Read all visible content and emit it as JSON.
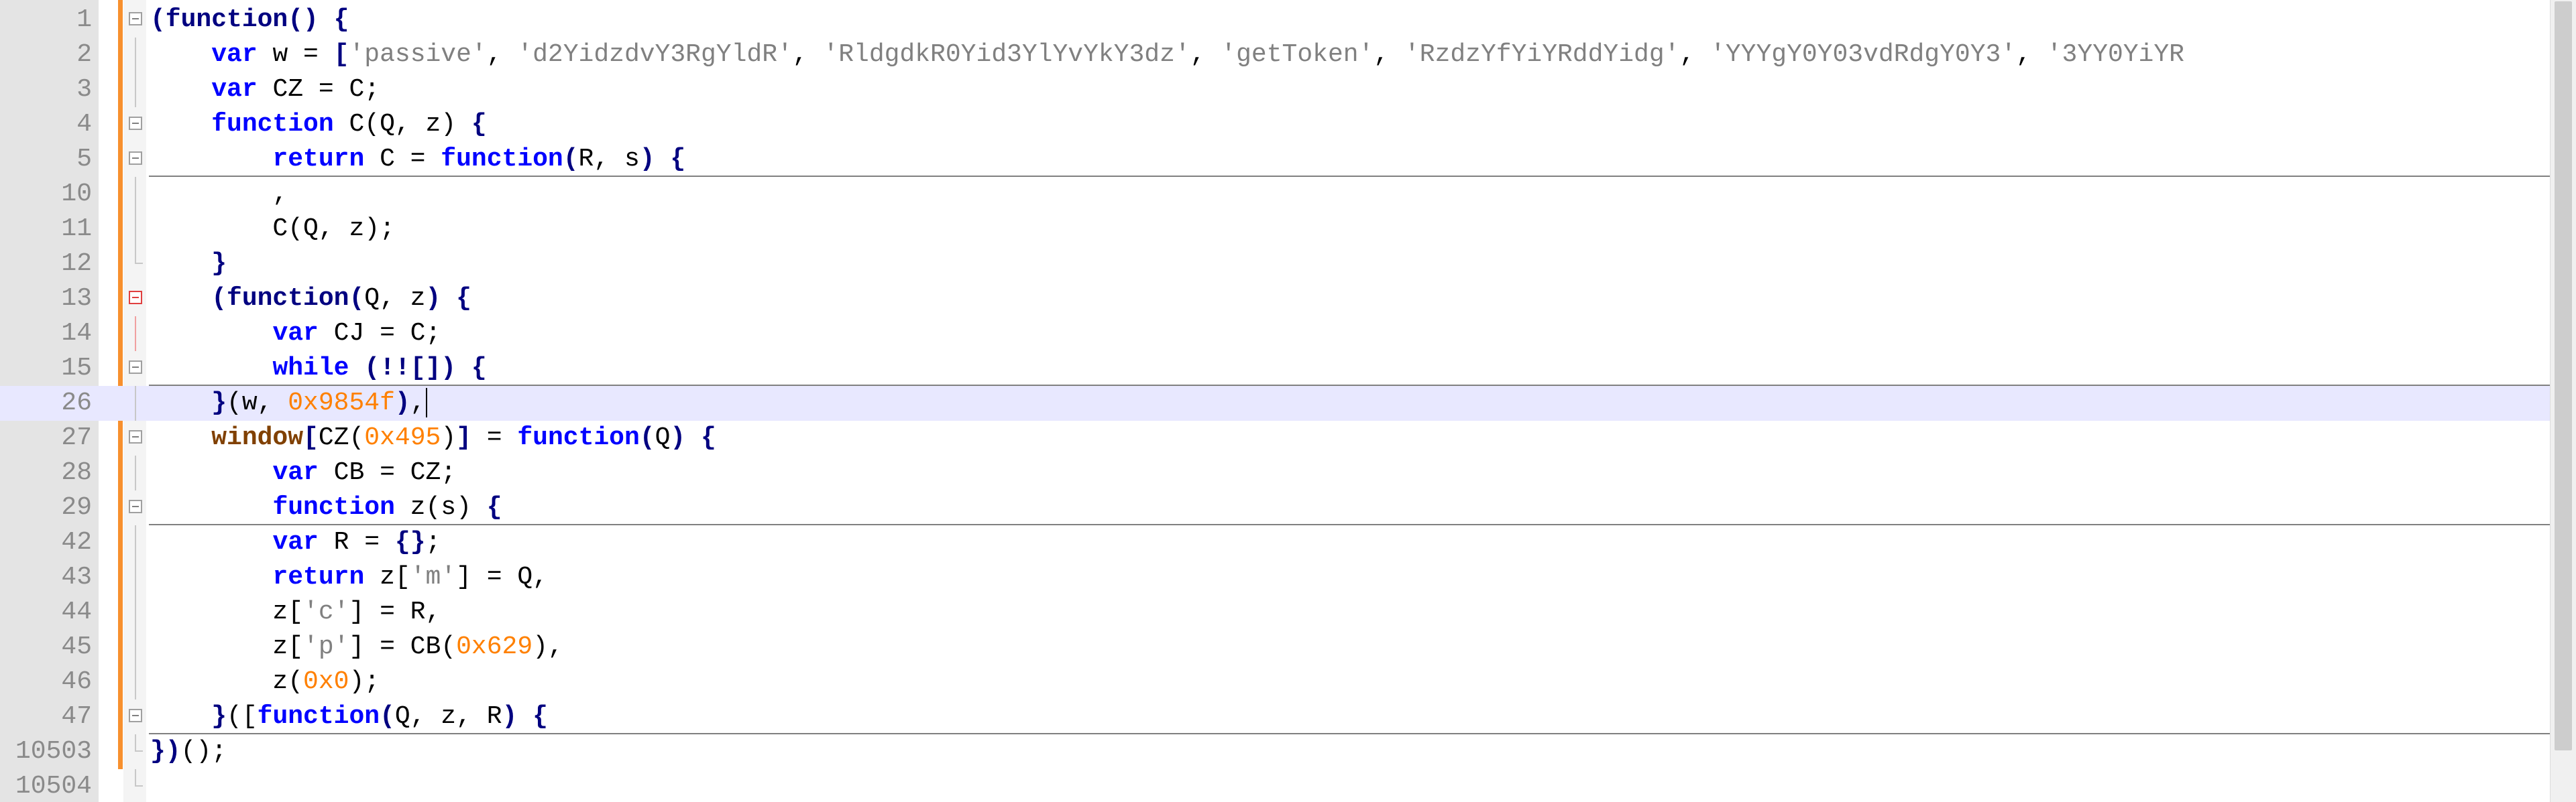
{
  "editor": {
    "language": "JavaScript",
    "colors": {
      "keyword": "#0000ff",
      "operator": "#000080",
      "string": "#808080",
      "number": "#ff8000",
      "window_object": "#804000",
      "current_line": "#e8e8ff",
      "change_bar": "#f7902e",
      "gutter": "#e4e4e4"
    },
    "lines": [
      {
        "num": "1",
        "fold": "box",
        "tokens": [
          [
            "br",
            "(function() {"
          ]
        ]
      },
      {
        "num": "2",
        "fold": "stem",
        "tokens": [
          [
            "t",
            "    "
          ],
          [
            "kw",
            "var"
          ],
          [
            "t",
            " w = "
          ],
          [
            "br",
            "["
          ],
          [
            "str",
            "'passive'"
          ],
          [
            "t",
            ", "
          ],
          [
            "str",
            "'d2YidzdvY3RgYldR'"
          ],
          [
            "t",
            ", "
          ],
          [
            "str",
            "'RldgdkR0Yid3YlYvYkY3dz'"
          ],
          [
            "t",
            ", "
          ],
          [
            "str",
            "'getToken'"
          ],
          [
            "t",
            ", "
          ],
          [
            "str",
            "'RzdzYfYiYRddYidg'"
          ],
          [
            "t",
            ", "
          ],
          [
            "str",
            "'YYYgY0Y03vdRdgY0Y3'"
          ],
          [
            "t",
            ", "
          ],
          [
            "str",
            "'3YY0YiYR"
          ]
        ]
      },
      {
        "num": "3",
        "fold": "stem",
        "tokens": [
          [
            "t",
            "    "
          ],
          [
            "kw",
            "var"
          ],
          [
            "t",
            " CZ = C;"
          ]
        ]
      },
      {
        "num": "4",
        "fold": "box",
        "tokens": [
          [
            "t",
            "    "
          ],
          [
            "kw",
            "function"
          ],
          [
            "t",
            " C(Q, z) "
          ],
          [
            "br",
            "{"
          ]
        ]
      },
      {
        "num": "5",
        "fold": "box-line",
        "tokens": [
          [
            "t",
            "        "
          ],
          [
            "kw",
            "return"
          ],
          [
            "t",
            " C = "
          ],
          [
            "kw",
            "function"
          ],
          [
            "br",
            "("
          ],
          [
            "t",
            "R, s"
          ],
          [
            "br",
            ")"
          ],
          [
            "t",
            " "
          ],
          [
            "br",
            "{"
          ]
        ]
      },
      {
        "num": "10",
        "fold": "stem",
        "tokens": [
          [
            "t",
            "        ,"
          ]
        ]
      },
      {
        "num": "11",
        "fold": "stem",
        "tokens": [
          [
            "t",
            "        C(Q, z);"
          ]
        ]
      },
      {
        "num": "12",
        "fold": "end",
        "tokens": [
          [
            "t",
            "    "
          ],
          [
            "br",
            "}"
          ]
        ]
      },
      {
        "num": "13",
        "fold": "box-red",
        "tokens": [
          [
            "t",
            "    "
          ],
          [
            "br",
            "(function"
          ],
          [
            "br",
            "("
          ],
          [
            "t",
            "Q, z"
          ],
          [
            "br",
            ")"
          ],
          [
            "t",
            " "
          ],
          [
            "br",
            "{"
          ]
        ]
      },
      {
        "num": "14",
        "fold": "stem-red",
        "tokens": [
          [
            "t",
            "        "
          ],
          [
            "kw",
            "var"
          ],
          [
            "t",
            " CJ = C;"
          ]
        ]
      },
      {
        "num": "15",
        "fold": "box-line",
        "tokens": [
          [
            "t",
            "        "
          ],
          [
            "kw",
            "while"
          ],
          [
            "t",
            " "
          ],
          [
            "br",
            "(!![])"
          ],
          [
            "t",
            " "
          ],
          [
            "br",
            "{"
          ]
        ]
      },
      {
        "num": "26",
        "fold": "current",
        "tokens": [
          [
            "t",
            "    "
          ],
          [
            "br",
            "}"
          ],
          [
            "t",
            "(w, "
          ],
          [
            "num",
            "0x9854f"
          ],
          [
            "br",
            ")"
          ],
          [
            "t",
            ","
          ]
        ]
      },
      {
        "num": "27",
        "fold": "box",
        "tokens": [
          [
            "t",
            "    "
          ],
          [
            "win",
            "window"
          ],
          [
            "br",
            "["
          ],
          [
            "t",
            "CZ("
          ],
          [
            "num",
            "0x495"
          ],
          [
            "t",
            ")"
          ],
          [
            "br",
            "]"
          ],
          [
            "t",
            " = "
          ],
          [
            "kw",
            "function"
          ],
          [
            "br",
            "("
          ],
          [
            "t",
            "Q"
          ],
          [
            "br",
            ")"
          ],
          [
            "t",
            " "
          ],
          [
            "br",
            "{"
          ]
        ]
      },
      {
        "num": "28",
        "fold": "stem",
        "tokens": [
          [
            "t",
            "        "
          ],
          [
            "kw",
            "var"
          ],
          [
            "t",
            " CB = CZ;"
          ]
        ]
      },
      {
        "num": "29",
        "fold": "box-line",
        "tokens": [
          [
            "t",
            "        "
          ],
          [
            "kw",
            "function"
          ],
          [
            "t",
            " z(s) "
          ],
          [
            "br",
            "{"
          ]
        ]
      },
      {
        "num": "42",
        "fold": "stem",
        "tokens": [
          [
            "t",
            "        "
          ],
          [
            "kw",
            "var"
          ],
          [
            "t",
            " R = "
          ],
          [
            "br",
            "{}"
          ],
          [
            "t",
            ";"
          ]
        ]
      },
      {
        "num": "43",
        "fold": "stem",
        "tokens": [
          [
            "t",
            "        "
          ],
          [
            "kw",
            "return"
          ],
          [
            "t",
            " z["
          ],
          [
            "str",
            "'m'"
          ],
          [
            "t",
            "] = Q,"
          ]
        ]
      },
      {
        "num": "44",
        "fold": "stem",
        "tokens": [
          [
            "t",
            "        z["
          ],
          [
            "str",
            "'c'"
          ],
          [
            "t",
            "] = R,"
          ]
        ]
      },
      {
        "num": "45",
        "fold": "stem",
        "tokens": [
          [
            "t",
            "        z["
          ],
          [
            "str",
            "'p'"
          ],
          [
            "t",
            "] = CB("
          ],
          [
            "num",
            "0x629"
          ],
          [
            "t",
            "),"
          ]
        ]
      },
      {
        "num": "46",
        "fold": "stem",
        "tokens": [
          [
            "t",
            "        z("
          ],
          [
            "num",
            "0x0"
          ],
          [
            "t",
            ");"
          ]
        ]
      },
      {
        "num": "47",
        "fold": "box-line",
        "tokens": [
          [
            "t",
            "    "
          ],
          [
            "br",
            "}"
          ],
          [
            "t",
            "(["
          ],
          [
            "kw",
            "function"
          ],
          [
            "br",
            "("
          ],
          [
            "t",
            "Q, z, R"
          ],
          [
            "br",
            ")"
          ],
          [
            "t",
            " "
          ],
          [
            "br",
            "{"
          ]
        ]
      },
      {
        "num": "10503",
        "fold": "end",
        "tokens": [
          [
            "br",
            "})"
          ],
          [
            "t",
            "();"
          ]
        ]
      },
      {
        "num": "10504",
        "fold": "end",
        "tokens": []
      }
    ]
  }
}
